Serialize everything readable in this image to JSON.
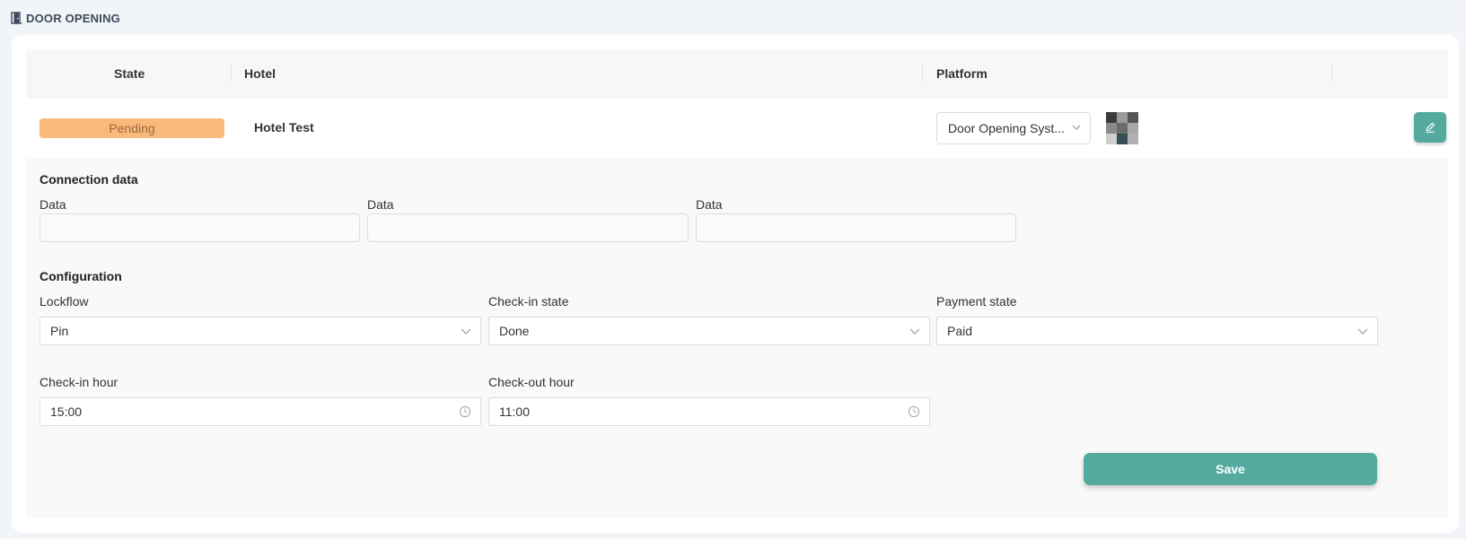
{
  "header": {
    "title": "DOOR OPENING",
    "icon": "door-icon"
  },
  "table": {
    "columns": [
      "State",
      "Hotel",
      "Platform"
    ],
    "row": {
      "state": "Pending",
      "state_color": "#f9b97a",
      "hotel": "Hotel Test",
      "platform": "Door Opening Syst..."
    }
  },
  "connection": {
    "title": "Connection data",
    "fields": [
      {
        "label": "Data",
        "value": ""
      },
      {
        "label": "Data",
        "value": ""
      },
      {
        "label": "Data",
        "value": ""
      }
    ]
  },
  "configuration": {
    "title": "Configuration",
    "lockflow": {
      "label": "Lockflow",
      "value": "Pin"
    },
    "checkin_state": {
      "label": "Check-in state",
      "value": "Done"
    },
    "payment_state": {
      "label": "Payment state",
      "value": "Paid"
    },
    "checkin_hour": {
      "label": "Check-in hour",
      "value": "15:00"
    },
    "checkout_hour": {
      "label": "Check-out hour",
      "value": "11:00"
    }
  },
  "actions": {
    "save_label": "Save",
    "accent": "#55aaa0"
  }
}
